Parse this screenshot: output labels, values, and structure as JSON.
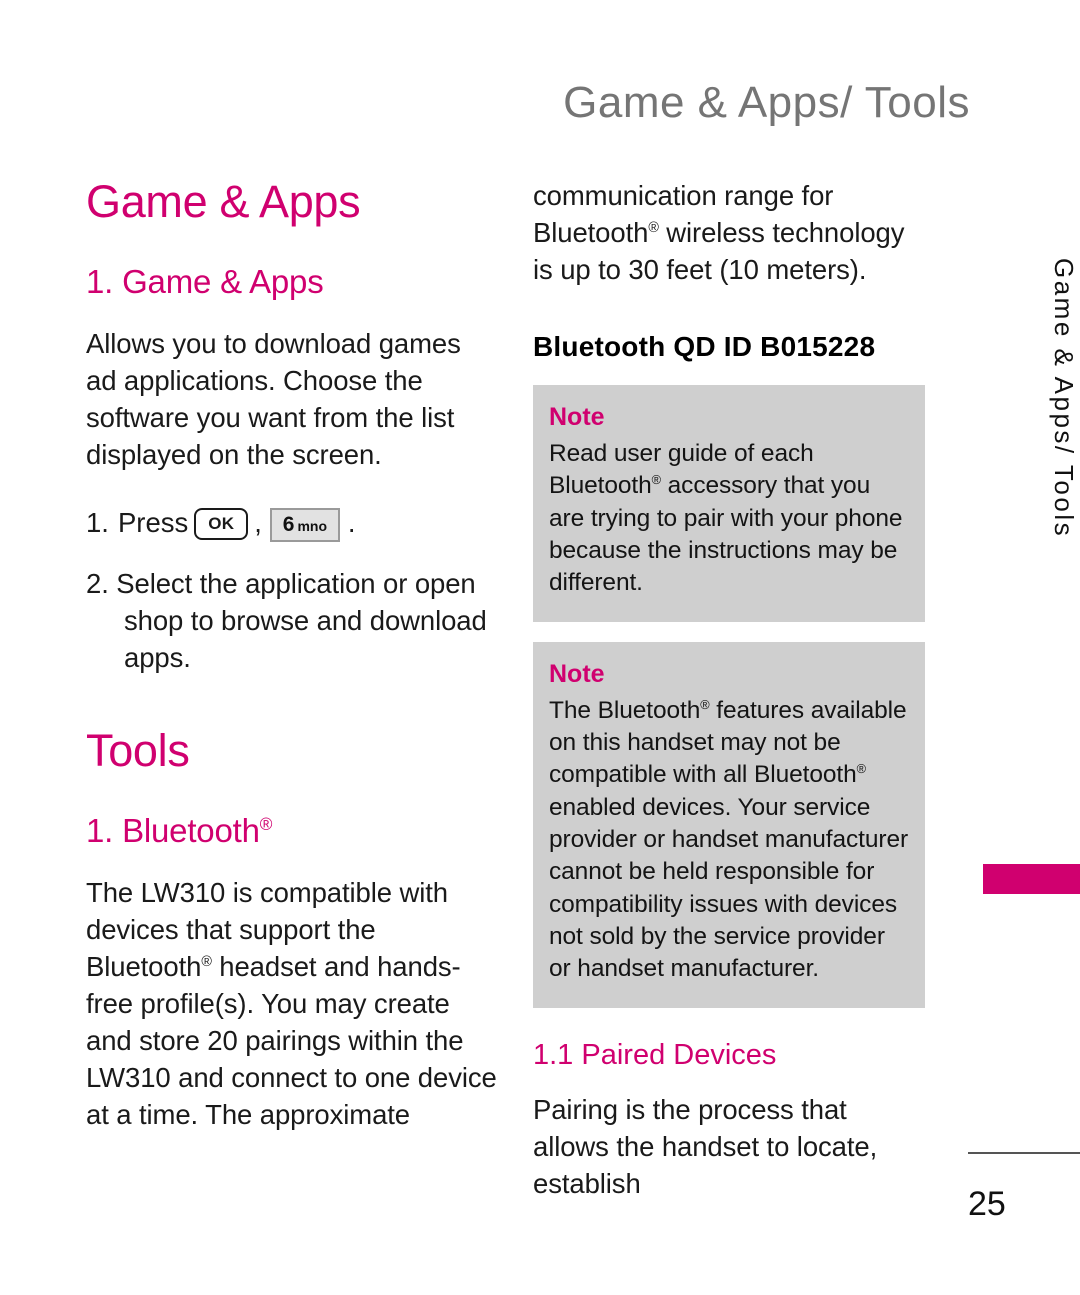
{
  "header": {
    "running_title": "Game & Apps/ Tools"
  },
  "left_column": {
    "heading_major": "Game & Apps",
    "heading_minor": "1. Game & Apps",
    "intro_paragraph": "Allows you to download games ad applications. Choose the software you want from the list displayed on the screen.",
    "step1": {
      "number": "1.",
      "text_before": "Press",
      "key_ok": "OK",
      "comma": ",",
      "key_num_digit": "6",
      "key_num_letters": "mno",
      "period": "."
    },
    "step2": "2. Select the application or open shop to browse and download apps.",
    "tools_heading": "Tools",
    "bluetooth_heading_prefix": "1. Bluetooth",
    "bluetooth_heading_reg": "®",
    "bluetooth_paragraph_part1": "The LW310 is compatible with devices that support the Bluetooth",
    "bluetooth_paragraph_part2": " headset and hands-free profile(s). You may create and store 20 pairings within the LW310 and connect to one device at a time. The approximate"
  },
  "right_column": {
    "continued_paragraph_part1": "communication range for Bluetooth",
    "continued_paragraph_part2": " wireless technology is up to 30 feet (10 meters).",
    "qd_id_heading": "Bluetooth QD ID B015228",
    "notes": [
      {
        "label": "Note",
        "body_part1": "Read user guide of each Bluetooth",
        "body_part2": " accessory that you are trying to pair with your phone because the instructions may be different."
      },
      {
        "label": "Note",
        "body_part1": "The Bluetooth",
        "body_part2": " features available on this handset may not be compatible with all Bluetooth",
        "body_part3": " enabled devices. Your service provider or handset manufacturer cannot be held responsible for compatibility issues with devices not sold by the service provider or handset manufacturer."
      }
    ],
    "paired_devices_heading": "1.1 Paired Devices",
    "paired_devices_paragraph": "Pairing is the process that allows the handset to locate, establish"
  },
  "sidebar": {
    "tab_label": "Game & Apps/ Tools"
  },
  "footer": {
    "page_number": "25"
  },
  "colors": {
    "accent_magenta": "#d0006f",
    "header_gray": "#757575",
    "note_background": "#cfcfcf",
    "body_black": "#1a1a1a"
  }
}
